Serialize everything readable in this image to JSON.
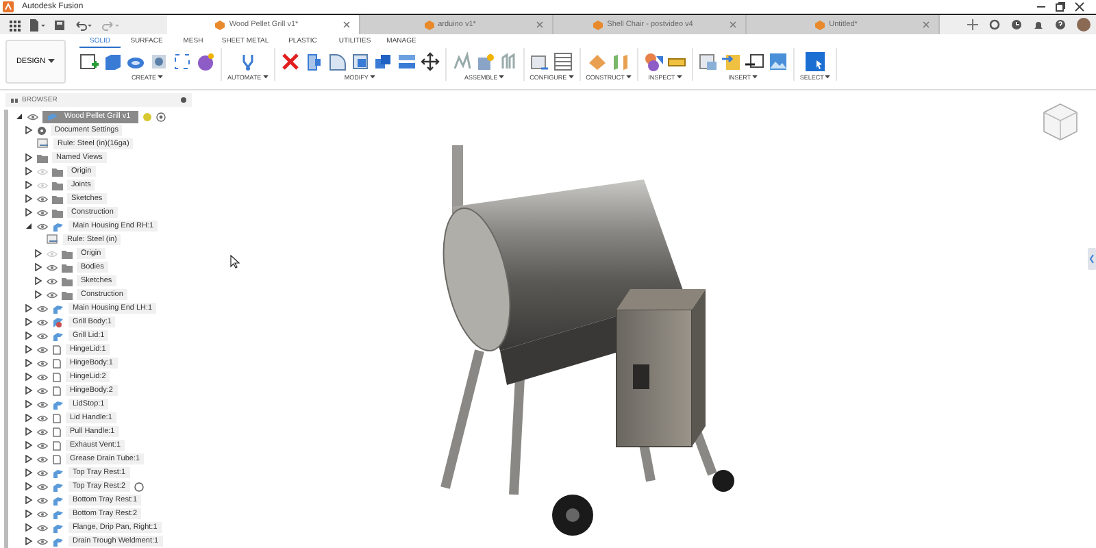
{
  "window": {
    "title": "Autodesk Fusion"
  },
  "document_tabs": [
    {
      "label": "Wood Pellet Grill v1*",
      "selected": true
    },
    {
      "label": "arduino v1*",
      "selected": false
    },
    {
      "label": "Shell Chair - postvideo v4",
      "selected": false
    },
    {
      "label": "Untitled*",
      "selected": false
    }
  ],
  "workspace": {
    "label": "DESIGN"
  },
  "toolbar_tabs": [
    {
      "label": "SOLID",
      "selected": true
    },
    {
      "label": "SURFACE",
      "selected": false
    },
    {
      "label": "MESH",
      "selected": false
    },
    {
      "label": "SHEET METAL",
      "selected": false
    },
    {
      "label": "PLASTIC",
      "selected": false
    },
    {
      "label": "UTILITIES",
      "selected": false
    },
    {
      "label": "MANAGE",
      "selected": false
    }
  ],
  "toolbar_groups": [
    {
      "label": "CREATE"
    },
    {
      "label": "AUTOMATE"
    },
    {
      "label": "MODIFY"
    },
    {
      "label": "ASSEMBLE"
    },
    {
      "label": "CONFIGURE"
    },
    {
      "label": "CONSTRUCT"
    },
    {
      "label": "INSPECT"
    },
    {
      "label": "INSERT"
    },
    {
      "label": "SELECT"
    }
  ],
  "browser": {
    "title": "BROWSER",
    "tree": [
      {
        "kind": "root",
        "label": "Wood Pellet Grill v1",
        "visible": true,
        "expanded": true,
        "children": [
          {
            "kind": "settings",
            "label": "Document Settings",
            "expanded": false
          },
          {
            "kind": "rule",
            "label": "Rule: Steel (in)(16ga)"
          },
          {
            "kind": "folder",
            "label": "Named Views",
            "expanded": false
          },
          {
            "kind": "folder",
            "label": "Origin",
            "visible": false,
            "expanded": false
          },
          {
            "kind": "folder",
            "label": "Joints",
            "visible": false,
            "expanded": false
          },
          {
            "kind": "folder",
            "label": "Sketches",
            "visible": true,
            "expanded": false
          },
          {
            "kind": "folder",
            "label": "Construction",
            "visible": true,
            "expanded": false
          },
          {
            "kind": "component",
            "label": "Main Housing End RH:1",
            "visible": true,
            "expanded": true,
            "children": [
              {
                "kind": "rule",
                "label": "Rule: Steel (in)"
              },
              {
                "kind": "folder",
                "label": "Origin",
                "visible": false,
                "expanded": false
              },
              {
                "kind": "folder",
                "label": "Bodies",
                "visible": true,
                "expanded": false
              },
              {
                "kind": "folder",
                "label": "Sketches",
                "visible": true,
                "expanded": false
              },
              {
                "kind": "folder",
                "label": "Construction",
                "visible": true,
                "expanded": false
              }
            ]
          },
          {
            "kind": "component",
            "label": "Main Housing End LH:1",
            "visible": true,
            "expanded": false
          },
          {
            "kind": "assembly",
            "label": "Grill Body:1",
            "visible": true,
            "expanded": false
          },
          {
            "kind": "component",
            "label": "Grill Lid:1",
            "visible": true,
            "expanded": false
          },
          {
            "kind": "body",
            "label": "HingeLid:1",
            "visible": true,
            "expanded": false
          },
          {
            "kind": "body",
            "label": "HingeBody:1",
            "visible": true,
            "expanded": false
          },
          {
            "kind": "body",
            "label": "HingeLid:2",
            "visible": true,
            "expanded": false
          },
          {
            "kind": "body",
            "label": "HingeBody:2",
            "visible": true,
            "expanded": false
          },
          {
            "kind": "component",
            "label": "LidStop:1",
            "visible": true,
            "expanded": false
          },
          {
            "kind": "body",
            "label": "Lid Handle:1",
            "visible": true,
            "expanded": false
          },
          {
            "kind": "body",
            "label": "Pull Handle:1",
            "visible": true,
            "expanded": false
          },
          {
            "kind": "body",
            "label": "Exhaust Vent:1",
            "visible": true,
            "expanded": false
          },
          {
            "kind": "body",
            "label": "Grease Drain Tube:1",
            "visible": true,
            "expanded": false
          },
          {
            "kind": "component",
            "label": "Top Tray Rest:1",
            "visible": true,
            "expanded": false
          },
          {
            "kind": "component",
            "label": "Top Tray Rest:2",
            "visible": true,
            "expanded": false,
            "pin": true
          },
          {
            "kind": "component",
            "label": "Bottom Tray Rest:1",
            "visible": true,
            "expanded": false
          },
          {
            "kind": "component",
            "label": "Bottom Tray Rest:2",
            "visible": true,
            "expanded": false
          },
          {
            "kind": "component",
            "label": "Flange, Drip Pan, Right:1",
            "visible": true,
            "expanded": false
          },
          {
            "kind": "component",
            "label": "Drain Trough Weldment:1",
            "visible": true,
            "expanded": false
          }
        ]
      }
    ]
  }
}
